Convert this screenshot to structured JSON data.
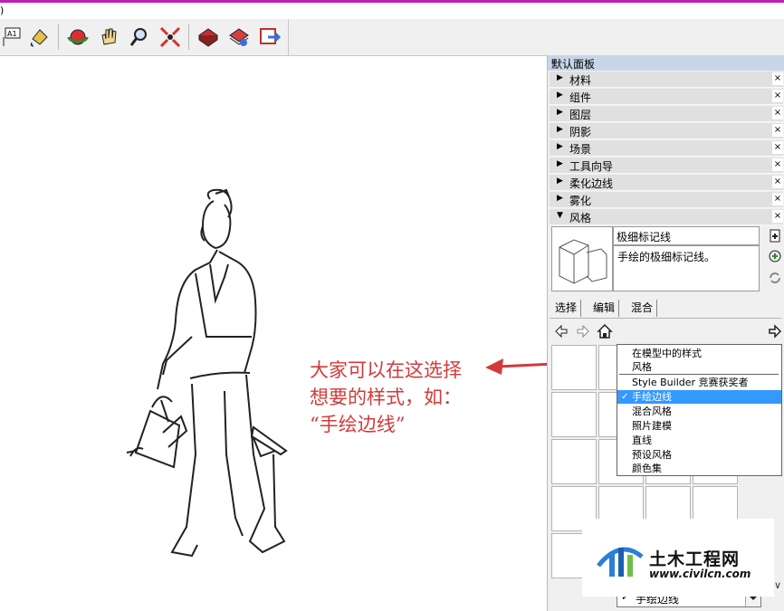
{
  "menubar": {
    "fragment": ")"
  },
  "panel": {
    "title": "默认面板",
    "trays": [
      {
        "label": "材料"
      },
      {
        "label": "组件"
      },
      {
        "label": "图层"
      },
      {
        "label": "阴影"
      },
      {
        "label": "场景"
      },
      {
        "label": "工具向导"
      },
      {
        "label": "柔化边线"
      },
      {
        "label": "雾化"
      },
      {
        "label": "风格"
      }
    ],
    "close_glyph": "×",
    "pin_glyph": "ᵖ",
    "style": {
      "name": "极细标记线",
      "description": "手绘的极细标记线。"
    },
    "tabs": [
      "选择",
      "编辑",
      "混合"
    ],
    "selector": {
      "check": "✓",
      "value": "手绘边线"
    }
  },
  "dropdown": {
    "options": [
      {
        "label": "在模型中的样式"
      },
      {
        "label": "风格"
      },
      {
        "label": "Style Builder 竞赛获奖者"
      },
      {
        "label": "手绘边线"
      },
      {
        "label": "混合风格"
      },
      {
        "label": "照片建模"
      },
      {
        "label": "直线"
      },
      {
        "label": "预设风格"
      },
      {
        "label": "颜色集"
      }
    ],
    "selected_check": "✓"
  },
  "annotation": {
    "line1": "大家可以在这选择",
    "line2": "想要的样式，如：",
    "line3": "“手绘边线”",
    "color": "#d23a3a"
  },
  "watermark": {
    "brand": "土木工程网",
    "url": "www.civilcn.com"
  },
  "toolbar": {
    "label_icon_text": "A1"
  },
  "colors": {
    "accent": "#3399ff",
    "panel_title": "#c6d6e8",
    "topbar": "#c020b0"
  }
}
